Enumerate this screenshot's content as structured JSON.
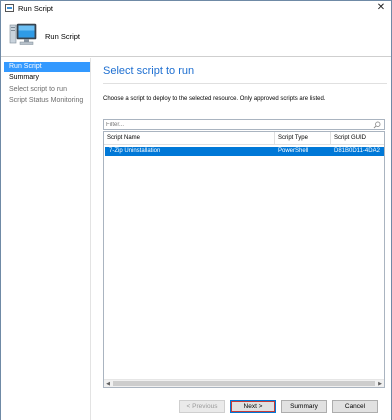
{
  "window": {
    "title": "Run Script",
    "close_glyph": "✕",
    "icon": "run-script-app-icon"
  },
  "header": {
    "title": "Run Script",
    "icon": "computer-icon"
  },
  "nav": {
    "items": [
      {
        "label": "Run Script",
        "state": "active"
      },
      {
        "label": "Summary",
        "state": "normal"
      },
      {
        "label": "Select script to run",
        "state": "future"
      },
      {
        "label": "Script Status Monitoring",
        "state": "future"
      }
    ]
  },
  "main": {
    "heading": "Select script to run",
    "description": "Choose a script to deploy to the selected resource. Only approved scripts are listed.",
    "filter_placeholder": "Filter...",
    "grid": {
      "columns": [
        "Script Name",
        "Script Type",
        "Script GUID"
      ],
      "rows": [
        {
          "name": "7-Zip Uninstallation",
          "type": "PowerShell",
          "guid": "D81B0D11-4DA2",
          "selected": true
        }
      ]
    }
  },
  "buttons": {
    "previous": "< Previous",
    "next": "Next >",
    "summary": "Summary",
    "cancel": "Cancel"
  },
  "colors": {
    "accent": "#1e6fd1",
    "selection": "#0078d7",
    "nav_active": "#3399ff"
  }
}
